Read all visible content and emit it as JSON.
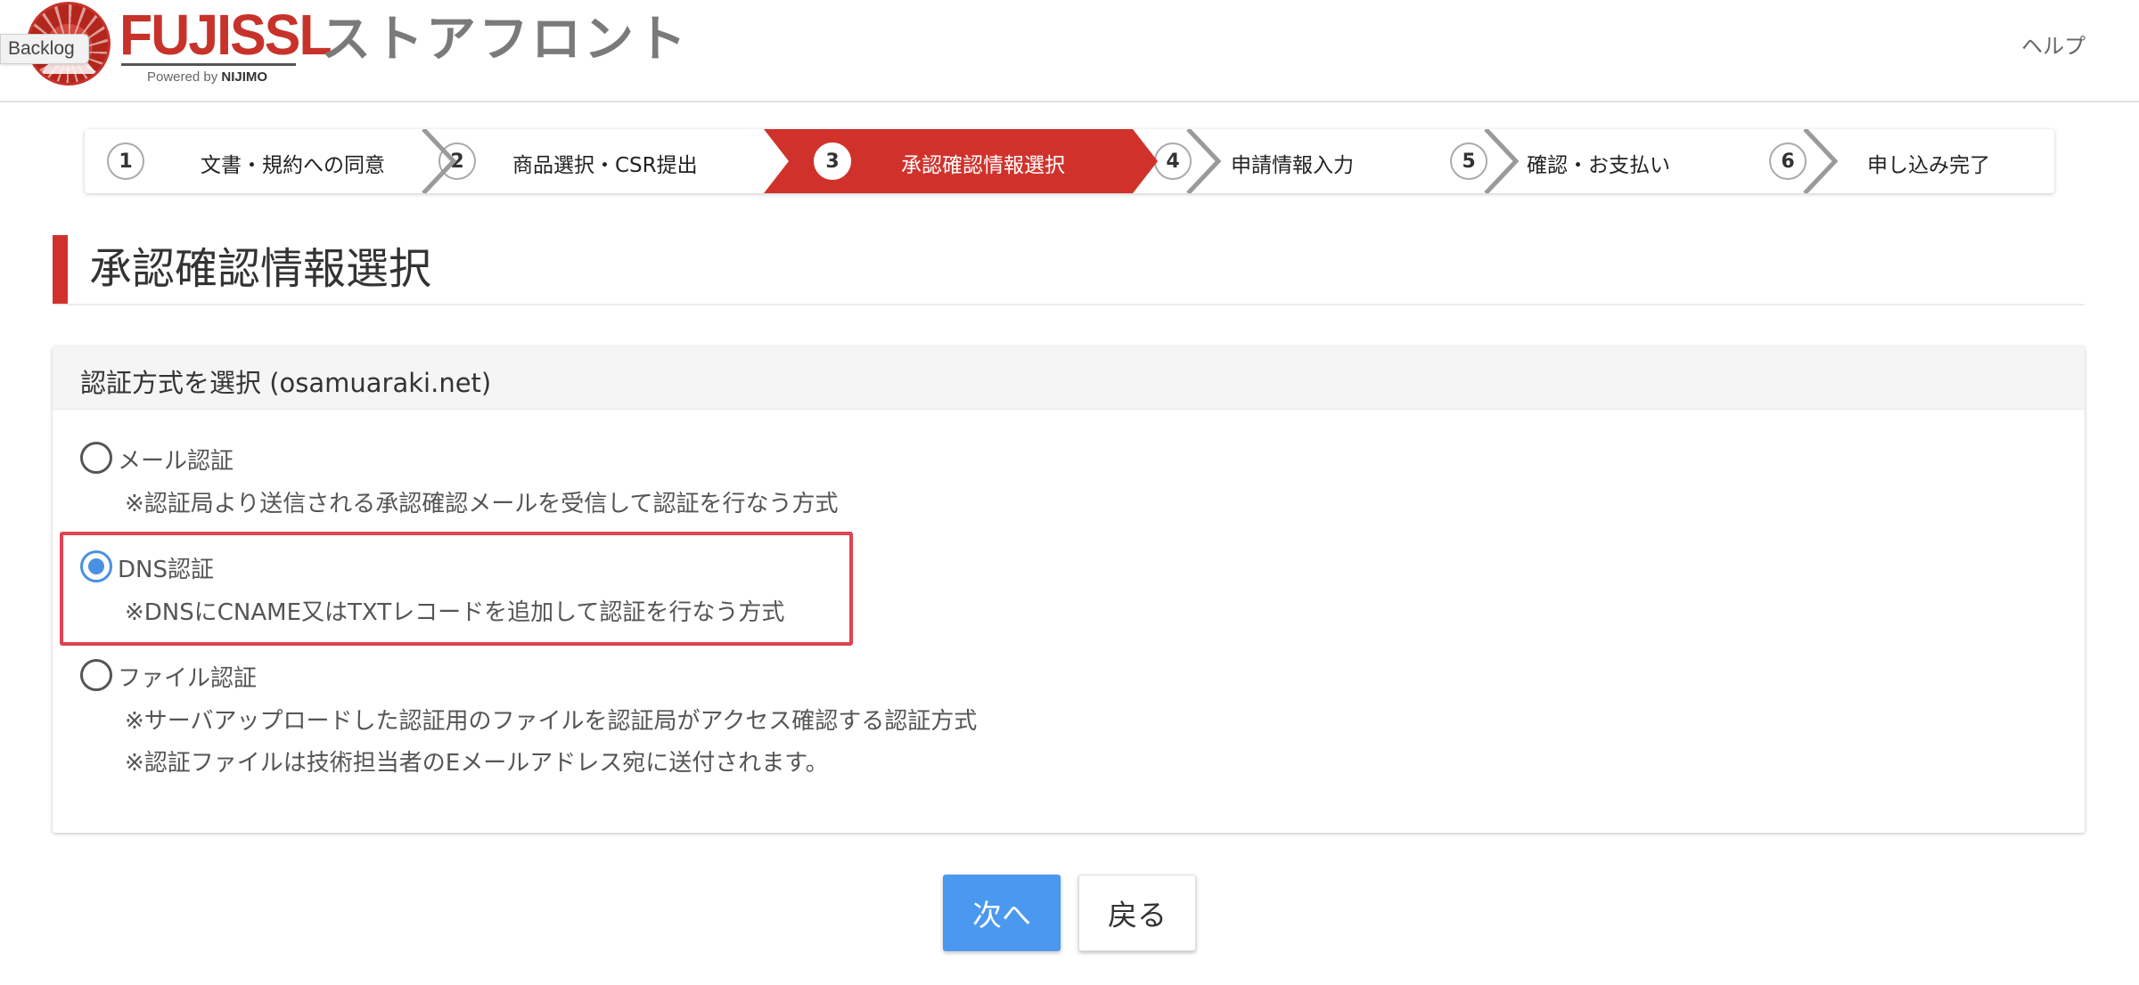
{
  "header": {
    "logo_text": "FUJISSL",
    "powered_by_prefix": "Powered by",
    "powered_by_brand": "NIJIMO",
    "backlog_badge": "Backlog",
    "store_title": "ストアフロント",
    "help_link": "ヘルプ"
  },
  "stepper": {
    "steps": [
      {
        "number": "1",
        "label": "文書・規約への同意",
        "active": false
      },
      {
        "number": "2",
        "label": "商品選択・CSR提出",
        "active": false
      },
      {
        "number": "3",
        "label": "承認確認情報選択",
        "active": true
      },
      {
        "number": "4",
        "label": "申請情報入力",
        "active": false
      },
      {
        "number": "5",
        "label": "確認・お支払い",
        "active": false
      },
      {
        "number": "6",
        "label": "申し込み完了",
        "active": false
      }
    ]
  },
  "page": {
    "title": "承認確認情報選択"
  },
  "card": {
    "title": "認証方式を選択 (osamuaraki.net)",
    "options": [
      {
        "label": "メール認証",
        "checked": false,
        "notes": [
          "※認証局より送信される承認確認メールを受信して認証を行なう方式"
        ]
      },
      {
        "label": "DNS認証",
        "checked": true,
        "notes": [
          "※DNSにCNAME又はTXTレコードを追加して認証を行なう方式"
        ]
      },
      {
        "label": "ファイル認証",
        "checked": false,
        "notes": [
          "※サーバアップロードした認証用のファイルを認証局がアクセス確認する認証方式",
          "※認証ファイルは技術担当者のEメールアドレス宛に送付されます。"
        ]
      }
    ]
  },
  "buttons": {
    "next": "次へ",
    "back": "戻る"
  },
  "colors": {
    "brand_red": "#d0322b",
    "primary_blue": "#4a98ef",
    "highlight_red": "#e04352"
  }
}
